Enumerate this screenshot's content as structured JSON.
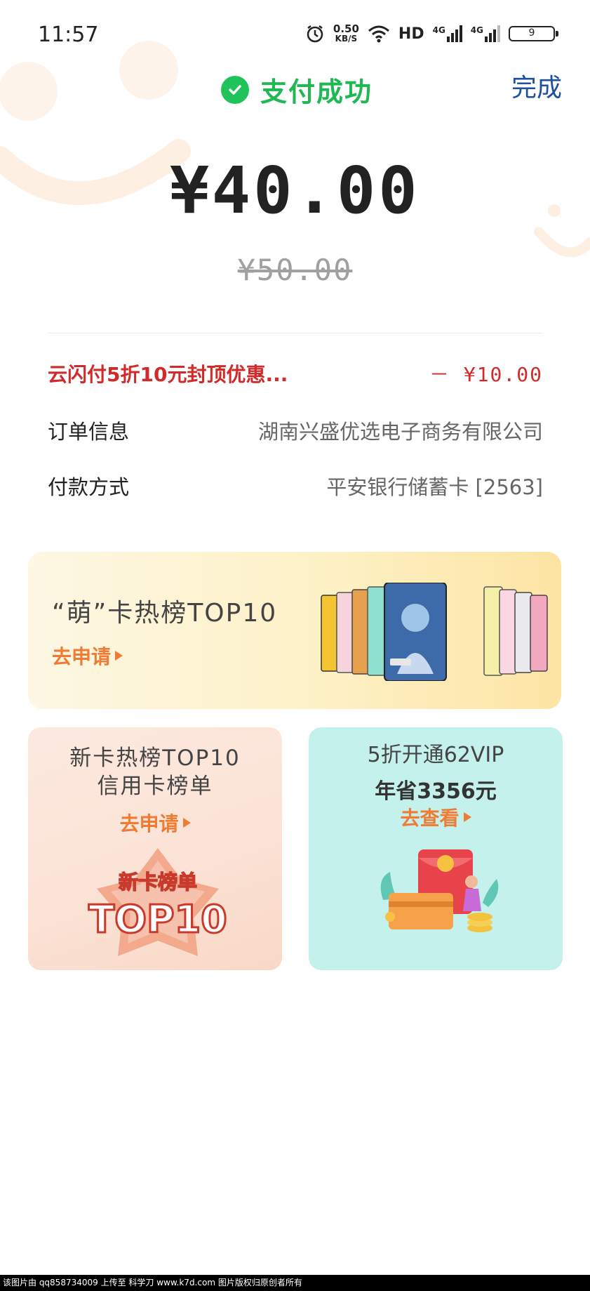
{
  "status_bar": {
    "time": "11:57",
    "net_speed_value": "0.50",
    "net_speed_unit": "KB/S",
    "hd_label": "HD",
    "network1": "4G",
    "network2": "4G",
    "battery": "9"
  },
  "header": {
    "status_text": "支付成功",
    "done_label": "完成"
  },
  "payment": {
    "amount": "¥40.00",
    "original_amount": "¥50.00"
  },
  "details": {
    "discount_label": "云闪付5折10元封顶优惠...",
    "discount_value": "－ ¥10.00",
    "order_label": "订单信息",
    "order_value": "湖南兴盛优选电子商务有限公司",
    "method_label": "付款方式",
    "method_value": "平安银行储蓄卡 [2563]"
  },
  "banner": {
    "title": "“萌”卡热榜TOP10",
    "cta": "去申请"
  },
  "card_left": {
    "title": "新卡热榜TOP10",
    "subtitle": "信用卡榜单",
    "cta": "去申请",
    "badge_top": "新卡榜单",
    "badge_main": "TOP10"
  },
  "card_right": {
    "title": "5折开通62VIP",
    "subtitle": "年省3356元",
    "cta": "去查看"
  },
  "footer": {
    "watermark": "该图片由 qq858734009 上传至 科学刀 www.k7d.com 图片版权归原创者所有"
  },
  "colors": {
    "success_green": "#1fc35a",
    "link_blue": "#1e4fa0",
    "discount_red": "#d12a2a",
    "cta_orange": "#ef7b35"
  }
}
